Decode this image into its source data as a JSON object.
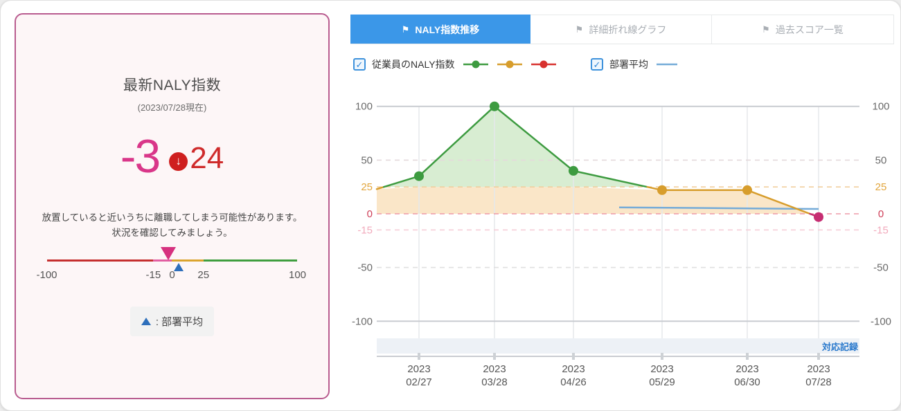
{
  "left_card": {
    "title": "最新NALY指数",
    "as_of": "(2023/07/28現在)",
    "score": "-3",
    "delta": "24",
    "delta_direction": "down",
    "warning_line1": "放置していると近いうちに離職してしまう可能性があります。",
    "warning_line2": "状況を確認してみましょう。",
    "scale": {
      "min": -100,
      "max": 100,
      "tick_values": [
        -100,
        -15,
        0,
        25,
        100
      ],
      "tick_labels": [
        "-100",
        "-15",
        "0",
        "25",
        "100"
      ],
      "score_marker_value": -3,
      "dept_avg_marker_value": 5,
      "segments": [
        {
          "from": -100,
          "to": -15,
          "color": "#c52f2f"
        },
        {
          "from": -15,
          "to": 0,
          "color": "#e25fa2"
        },
        {
          "from": 0,
          "to": 25,
          "color": "#dba42e"
        },
        {
          "from": 25,
          "to": 100,
          "color": "#3f9e3f"
        }
      ],
      "legend_text": ": 部署平均"
    }
  },
  "tabs": [
    {
      "label": "NALY指数推移",
      "active": true
    },
    {
      "label": "詳細折れ線グラフ",
      "active": false
    },
    {
      "label": "過去スコア一覧",
      "active": false
    }
  ],
  "chart_controls": {
    "employee_label": "従業員のNALY指数",
    "employee_checked": true,
    "dept_label": "部署平均",
    "dept_checked": true,
    "check_glyph": "✓"
  },
  "colors": {
    "good": "#3d9b40",
    "warn": "#d79d2c",
    "danger": "#c62d72",
    "legend_red": "#d8312e",
    "avg_blue": "#74abd8",
    "good_fill": "#d8edd2",
    "warn_fill": "#fae6c8",
    "grid_vertical": "#e5e8eb",
    "band_bg": "#edf1f6",
    "axis_line": "#c9ccd1",
    "date_label": "#555555",
    "tab_active": "#3b97e8",
    "accent_pink": "#d93689",
    "accent_red": "#cf2b2b"
  },
  "chart_data": {
    "type": "area",
    "title": "NALY指数推移",
    "categories": [
      [
        "2023",
        "02/27"
      ],
      [
        "2023",
        "03/28"
      ],
      [
        "2023",
        "04/26"
      ],
      [
        "2023",
        "05/29"
      ],
      [
        "2023",
        "06/30"
      ],
      [
        "2023",
        "07/28"
      ]
    ],
    "series": [
      {
        "name": "従業員のNALY指数",
        "type": "area-line",
        "values": [
          35,
          100,
          40,
          22,
          22,
          -3
        ],
        "lead_in_value": 23
      },
      {
        "name": "部署平均",
        "type": "line",
        "start_value": 6,
        "end_value": 4.5
      }
    ],
    "y_axis": [
      {
        "label": "100",
        "value": 100,
        "label_color": "#6a6a6a",
        "line_color": "#c9ccd1",
        "dashed": false
      },
      {
        "label": "50",
        "value": 50,
        "label_color": "#6a6a6a",
        "line_color": "#e4d9db",
        "dashed": true
      },
      {
        "label": "25",
        "value": 25,
        "label_color": "#e2a63d",
        "line_color": "#f1cf9e",
        "dashed": true
      },
      {
        "label": "0",
        "value": 0,
        "label_color": "#cf3f58",
        "line_color": "#ee9aa8",
        "dashed": true
      },
      {
        "label": "-15",
        "value": -15,
        "label_color": "#f2aabc",
        "line_color": "#f6ced8",
        "dashed": true
      },
      {
        "label": "-50",
        "value": -50,
        "label_color": "#6a6a6a",
        "line_color": "#dfdfdf",
        "dashed": true
      },
      {
        "label": "-100",
        "value": -100,
        "label_color": "#6a6a6a",
        "line_color": "#c9ccd1",
        "dashed": false
      }
    ],
    "ylim": [
      -100,
      100
    ],
    "zones": {
      "good_above": 25,
      "warn_range": [
        0,
        25
      ],
      "danger_below": 0
    },
    "grid": true,
    "legend_position": "top",
    "action_button": "対応記録"
  }
}
